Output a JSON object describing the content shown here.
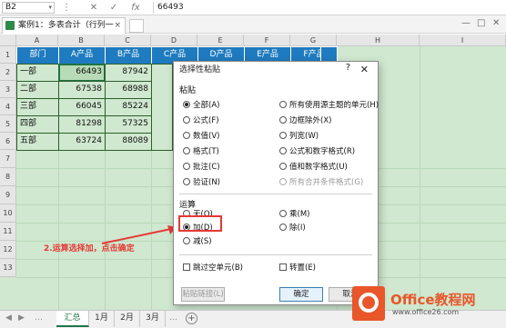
{
  "formula_bar": {
    "name_box": "B2",
    "buttons": [
      "⋮",
      "✕",
      "✓",
      "fx"
    ],
    "formula": "66493"
  },
  "workbook_tab": {
    "title": "案例1：多表合计（行列一致）*",
    "close": "×"
  },
  "window_controls": [
    "—",
    "□",
    "✕"
  ],
  "columns": [
    "A",
    "B",
    "C",
    "D",
    "E",
    "F",
    "G",
    "H",
    "I"
  ],
  "rows": [
    "1",
    "2",
    "3",
    "4",
    "5",
    "6",
    "7",
    "8",
    "9",
    "10",
    "11",
    "12",
    "13"
  ],
  "table": {
    "headers": [
      "部门",
      "A产品",
      "B产品",
      "C产品",
      "D产品",
      "E产品",
      "F产品"
    ],
    "data": [
      {
        "dept": "一部",
        "a": "66493",
        "b": "87942"
      },
      {
        "dept": "二部",
        "a": "67538",
        "b": "68988"
      },
      {
        "dept": "三部",
        "a": "66045",
        "b": "85224"
      },
      {
        "dept": "四部",
        "a": "81298",
        "b": "57325"
      },
      {
        "dept": "五部",
        "a": "63724",
        "b": "88089"
      }
    ]
  },
  "dialog": {
    "title": "选择性粘贴",
    "help": "?",
    "close": "✕",
    "paste_section": "粘贴",
    "paste_left": [
      "全部(A)",
      "公式(F)",
      "数值(V)",
      "格式(T)",
      "批注(C)",
      "验证(N)"
    ],
    "paste_right": [
      "所有使用源主题的单元(H)",
      "边框除外(X)",
      "列宽(W)",
      "公式和数字格式(R)",
      "值和数字格式(U)",
      "所有合并条件格式(G)"
    ],
    "operation_section": "运算",
    "operation_left": [
      "无(O)",
      "加(D)",
      "减(S)"
    ],
    "operation_right": [
      "乘(M)",
      "除(I)"
    ],
    "skip_blanks": "跳过空单元(B)",
    "transpose": "转置(E)",
    "paste_link": "粘贴链接(L)",
    "ok": "确定",
    "cancel": "取消"
  },
  "annotation": "2.运算选择加，点击确定",
  "sheet_tabs": {
    "tabs": [
      "汇总",
      "1月",
      "2月",
      "3月"
    ],
    "active": "汇总",
    "add": "+"
  },
  "watermark": {
    "brand": "Office教程网",
    "url": "www.office26.com"
  },
  "colors": {
    "header_fill": "#1f7bbf",
    "cell_fill": "#cfe8cf",
    "annotation": "#e53935",
    "brand": "#e8562a"
  }
}
